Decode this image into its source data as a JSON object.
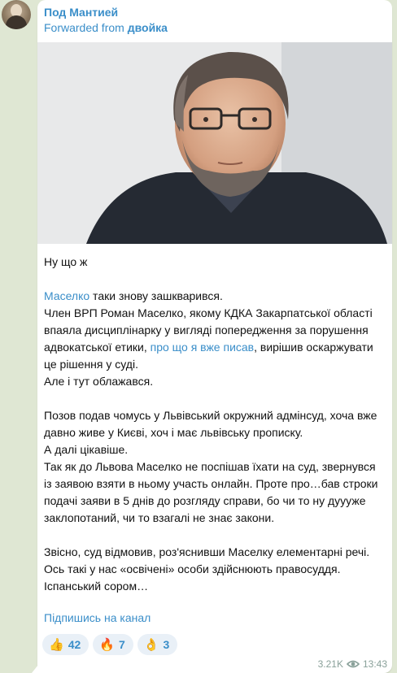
{
  "channel": {
    "name": "Под Мантией"
  },
  "forward": {
    "prefix": "Forwarded from",
    "source": "двойка"
  },
  "photo": {
    "description": "Portrait of a man with glasses and grey hair"
  },
  "post": {
    "l1": "Ну що ж",
    "l2_link": "Маселко",
    "l2_rest": " таки знову зашкварився.",
    "l3a": "Член ВРП Роман Маселко, якому КДКА Закарпатської області впаяла дисциплінарку у вигляді попередження за порушення адвокатської етики, ",
    "l3_link": "про що я вже писав",
    "l3b": ", вирішив оскаржувати це рішення у суді.",
    "l4": "Але і тут облажався.",
    "l5": "Позов подав чомусь у Львівський окружний адмінсуд, хоча вже давно живе у Києві, хоч і має львівську прописку.",
    "l6": "А далі цікавіше.",
    "l7": "Так як до Львова Маселко не поспішав їхати на суд, звернувся із заявою взяти в ньому участь онлайн. Проте про…бав строки подачі заяви в 5 днів до розгляду справи, бо чи то ну дуууже заклопотаний, чи то взагалі не знає закони.",
    "l8": "Звісно, суд відмовив, роз'яснивши Маселку елементарні речі.",
    "l9": "Ось такі у нас «освічені» особи здійснюють правосуддя.",
    "l10": "Іспанський сором…"
  },
  "subscribe": "Підпишись на канал",
  "reactions": [
    {
      "emoji": "👍",
      "count": "42"
    },
    {
      "emoji": "🔥",
      "count": "7"
    },
    {
      "emoji": "👌",
      "count": "3"
    }
  ],
  "meta": {
    "views": "3.21K",
    "time": "13:43"
  },
  "colors": {
    "accent": "#3a8ec9",
    "background": "#dfe7d3",
    "bubble": "#ffffff"
  }
}
